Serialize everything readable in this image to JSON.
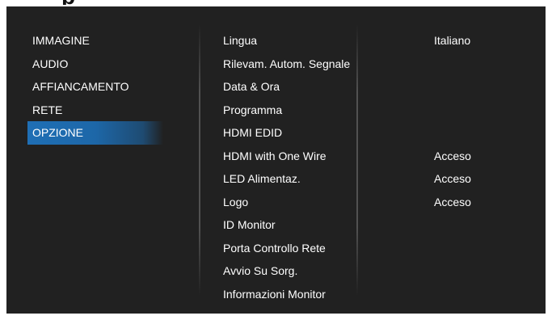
{
  "left_menu": {
    "items": [
      {
        "label": "IMMAGINE",
        "active": false
      },
      {
        "label": "AUDIO",
        "active": false
      },
      {
        "label": "AFFIANCAMENTO",
        "active": false
      },
      {
        "label": "RETE",
        "active": false
      },
      {
        "label": "OPZIONE",
        "active": true
      }
    ]
  },
  "options_menu": {
    "items": [
      {
        "label": "Lingua",
        "value": "Italiano"
      },
      {
        "label": "Rilevam. Autom. Segnale",
        "value": ""
      },
      {
        "label": "Data & Ora",
        "value": ""
      },
      {
        "label": "Programma",
        "value": ""
      },
      {
        "label": "HDMI EDID",
        "value": ""
      },
      {
        "label": "HDMI with One Wire",
        "value": "Acceso"
      },
      {
        "label": "LED Alimentaz.",
        "value": "Acceso"
      },
      {
        "label": "Logo",
        "value": "Acceso"
      },
      {
        "label": "ID Monitor",
        "value": ""
      },
      {
        "label": "Porta Controllo Rete",
        "value": ""
      },
      {
        "label": "Avvio Su Sorg.",
        "value": ""
      },
      {
        "label": "Informazioni Monitor",
        "value": ""
      }
    ]
  },
  "colors": {
    "panel_bg": "#212121",
    "highlight": "#1f6fb5",
    "text": "#ffffff"
  }
}
